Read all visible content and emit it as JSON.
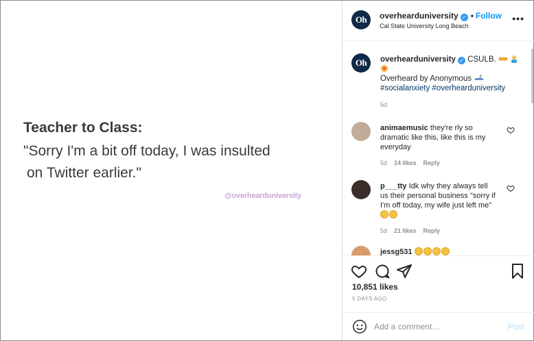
{
  "post_image": {
    "title": "Teacher to Class:",
    "quote_line1": "\"Sorry I'm a bit off today, I was insulted",
    "quote_line2": "on Twitter earlier.\"",
    "watermark": "@overhearduniversity"
  },
  "header": {
    "avatar_text": "Oh",
    "username": "overhearduniversity",
    "separator": "•",
    "follow_label": "Follow",
    "location": "Cal State University Long Beach",
    "more_icon": "more-horizontal-icon"
  },
  "caption": {
    "avatar_text": "Oh",
    "username": "overhearduniversity",
    "text": "CSULB.",
    "line2": "Overheard by Anonymous",
    "hashtags": "#socialanxiety #overhearduniversity",
    "time": "5d"
  },
  "comments": [
    {
      "username": "animaemusic",
      "text": "they're rly so dramatic like this, like this is my everyday",
      "time": "5d",
      "likes": "14 likes",
      "reply": "Reply"
    },
    {
      "username": "p___tty",
      "text": "Idk why they always tell us their personal business \"sorry if I'm off today, my wife just left me\"",
      "time": "5d",
      "likes": "21 likes",
      "reply": "Reply"
    },
    {
      "username": "jessg531",
      "text": ""
    }
  ],
  "actions": {
    "likes": "10,851 likes",
    "posted": "5 DAYS AGO"
  },
  "add_comment": {
    "placeholder": "Add a comment…",
    "post_label": "Post"
  },
  "colors": {
    "accent": "#0095f6",
    "hashtag": "#00376b",
    "muted": "#8e8e8e",
    "watermark": "#c9a7d6",
    "avatar_bg": "#0e2a47"
  }
}
